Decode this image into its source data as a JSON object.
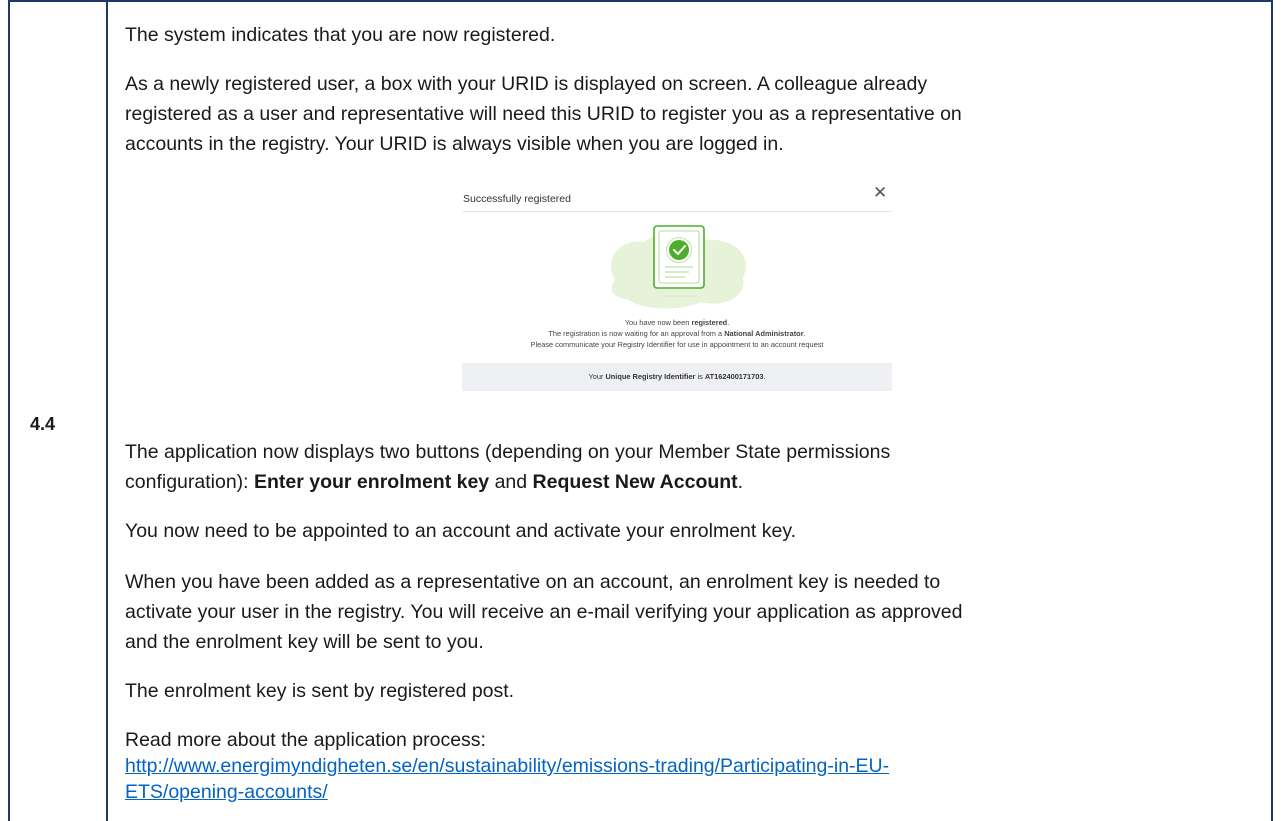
{
  "step": "4.4",
  "paragraphs": {
    "p1": "The system indicates that you are now registered.",
    "p2_line1": "As a newly registered user, a box with your URID is displayed on screen. A colleague already",
    "p2_line2": "registered as a user and representative will need this URID to register you as a representative on",
    "p2_line3": "accounts in the registry. Your URID is always visible when you are logged in.",
    "p3_line1": "The application now displays two buttons (depending on your Member State permissions",
    "p3_line2_a": "configuration): ",
    "p3_button1": "Enter your enrolment key",
    "p3_line2_b": " and ",
    "p3_button2": "Request New Account",
    "p3_line2_c": ".",
    "p4": "You now need to be appointed to an account and activate your enrolment key.",
    "p5_line1": "When you have been added as a representative on an account, an enrolment key is needed to",
    "p5_line2": "activate your user in the registry. You will receive an e-mail verifying your application as approved",
    "p5_line3": "and the enrolment key will be sent to you.",
    "p6": "The enrolment key is sent by registered post.",
    "p7": "Read more about the application process:",
    "link_line1": "http://www.energimyndigheten.se/en/sustainability/emissions-trading/Participating-in-EU-",
    "link_line2": "ETS/opening-accounts/"
  },
  "dialog": {
    "title": "Successfully registered",
    "close_icon": "close-icon",
    "illustration_icon": "document-check-icon",
    "line1_a": "You have now been ",
    "line1_b": "registered",
    "line1_c": ".",
    "line2_a": "The registration is now waiting for an approval from a ",
    "line2_b": "National Administrator",
    "line2_c": ".",
    "line3": "Please communicate your Registry Identifier for use in appointment to an account request",
    "footer_a": "Your ",
    "footer_b": "Unique Registry Identifier",
    "footer_c": " is ",
    "footer_d": "AT162400171703",
    "footer_e": "."
  },
  "colors": {
    "border": "#1f3864",
    "link": "#0563c1",
    "check_green": "#4caf2a",
    "blob_green": "#e6f3d9"
  }
}
